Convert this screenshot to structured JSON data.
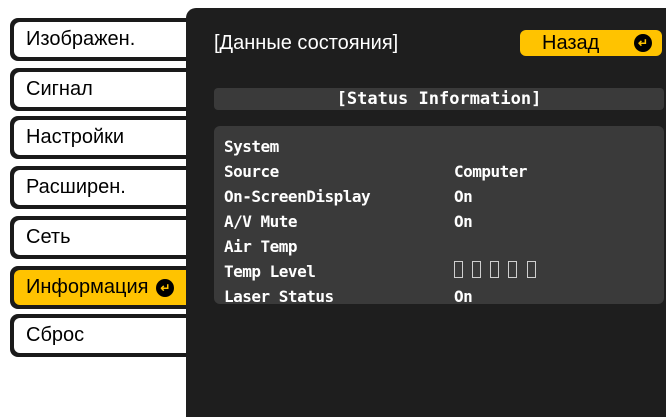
{
  "menu": {
    "items": [
      {
        "label": "Изображен.",
        "selected": false
      },
      {
        "label": "Сигнал",
        "selected": false
      },
      {
        "label": "Настройки",
        "selected": false
      },
      {
        "label": "Расширен.",
        "selected": false
      },
      {
        "label": "Сеть",
        "selected": false
      },
      {
        "label": "Информация",
        "selected": true
      },
      {
        "label": "Сброс",
        "selected": false
      }
    ]
  },
  "panel": {
    "title": "[Данные состояния]",
    "back_label": "Назад",
    "section_title": "[Status Information]",
    "rows": [
      {
        "key": "System",
        "value": ""
      },
      {
        "key": "Source",
        "value": "Computer"
      },
      {
        "key": "On-ScreenDisplay",
        "value": "On"
      },
      {
        "key": "A/V Mute",
        "value": "On"
      },
      {
        "key": "Air Temp",
        "value": ""
      },
      {
        "key": "Temp Level",
        "value": "",
        "cells": 5
      },
      {
        "key": "Laser Status",
        "value": "On"
      }
    ]
  },
  "colors": {
    "accent": "#ffc300",
    "panel_bg": "#1e1e1e",
    "row_bg": "#3a3a3a"
  },
  "icons": {
    "enter": "enter-return-icon"
  }
}
